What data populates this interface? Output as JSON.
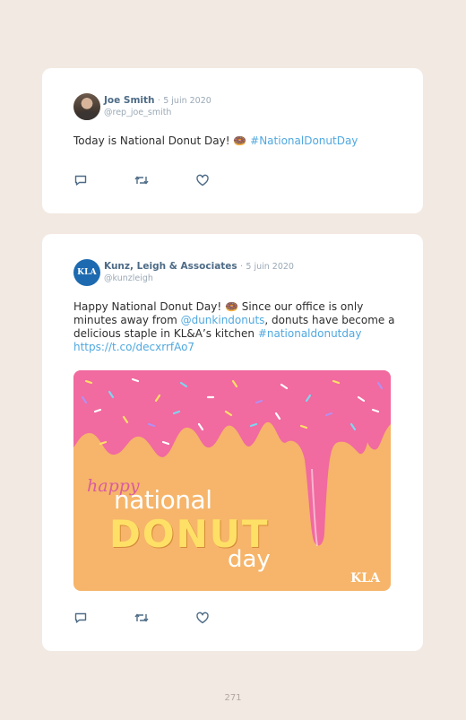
{
  "tweets": [
    {
      "author": "Joe Smith",
      "separator": "·",
      "date": "5 juin 2020",
      "handle": "@rep_joe_smith",
      "text_before": "Today is National Donut Day! 🍩 ",
      "hashtag": "#NationalDonutDay"
    },
    {
      "author": "Kunz, Leigh & Associates",
      "separator": "·",
      "date": "5 juin 2020",
      "handle": "@kunzleigh",
      "avatar_text": "KLA",
      "text_part1": "Happy National Donut Day! 🍩 Since our office is only minutes away from ",
      "mention": "@dunkindonuts",
      "text_part2": ", donuts have become a delicious staple in KL&A’s kitchen ",
      "hashtag": "#nationaldonutday",
      "url": "https://t.co/decxrrfAo7",
      "image": {
        "word_happy": "happy",
        "word_national": "national",
        "word_donut": "DONUT",
        "word_day": "day",
        "logo": "KLA"
      }
    }
  ],
  "page_number": "271",
  "colors": {
    "background": "#f2e9e2",
    "link": "#4fa8e0",
    "name": "#4d6b86",
    "icing": "#f16aa0",
    "image_base": "#f6b56a"
  },
  "icons": [
    "reply-icon",
    "retweet-icon",
    "like-icon"
  ]
}
